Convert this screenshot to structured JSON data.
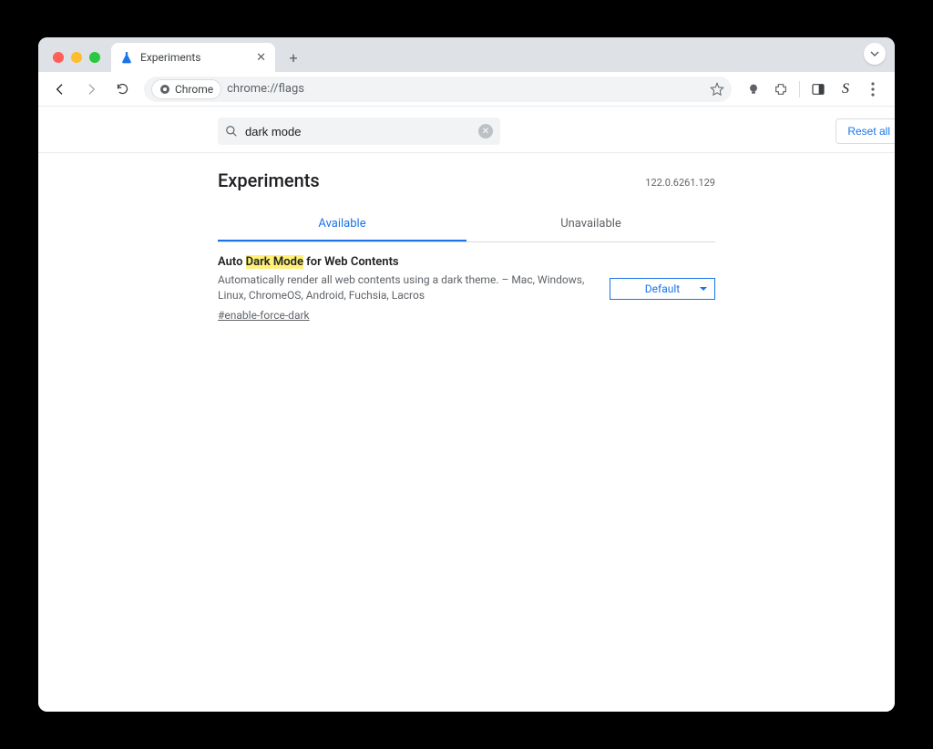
{
  "tab": {
    "title": "Experiments"
  },
  "omnibox": {
    "chip": "Chrome",
    "url": "chrome://flags"
  },
  "search": {
    "value": "dark mode"
  },
  "reset_label": "Reset all",
  "page_title": "Experiments",
  "version": "122.0.6261.129",
  "tabs": {
    "available": "Available",
    "unavailable": "Unavailable"
  },
  "experiment": {
    "title_prefix": "Auto ",
    "title_highlight": "Dark Mode",
    "title_suffix": " for Web Contents",
    "description": "Automatically render all web contents using a dark theme. – Mac, Windows, Linux, ChromeOS, Android, Fuchsia, Lacros",
    "hash": "#enable-force-dark",
    "select_value": "Default"
  }
}
